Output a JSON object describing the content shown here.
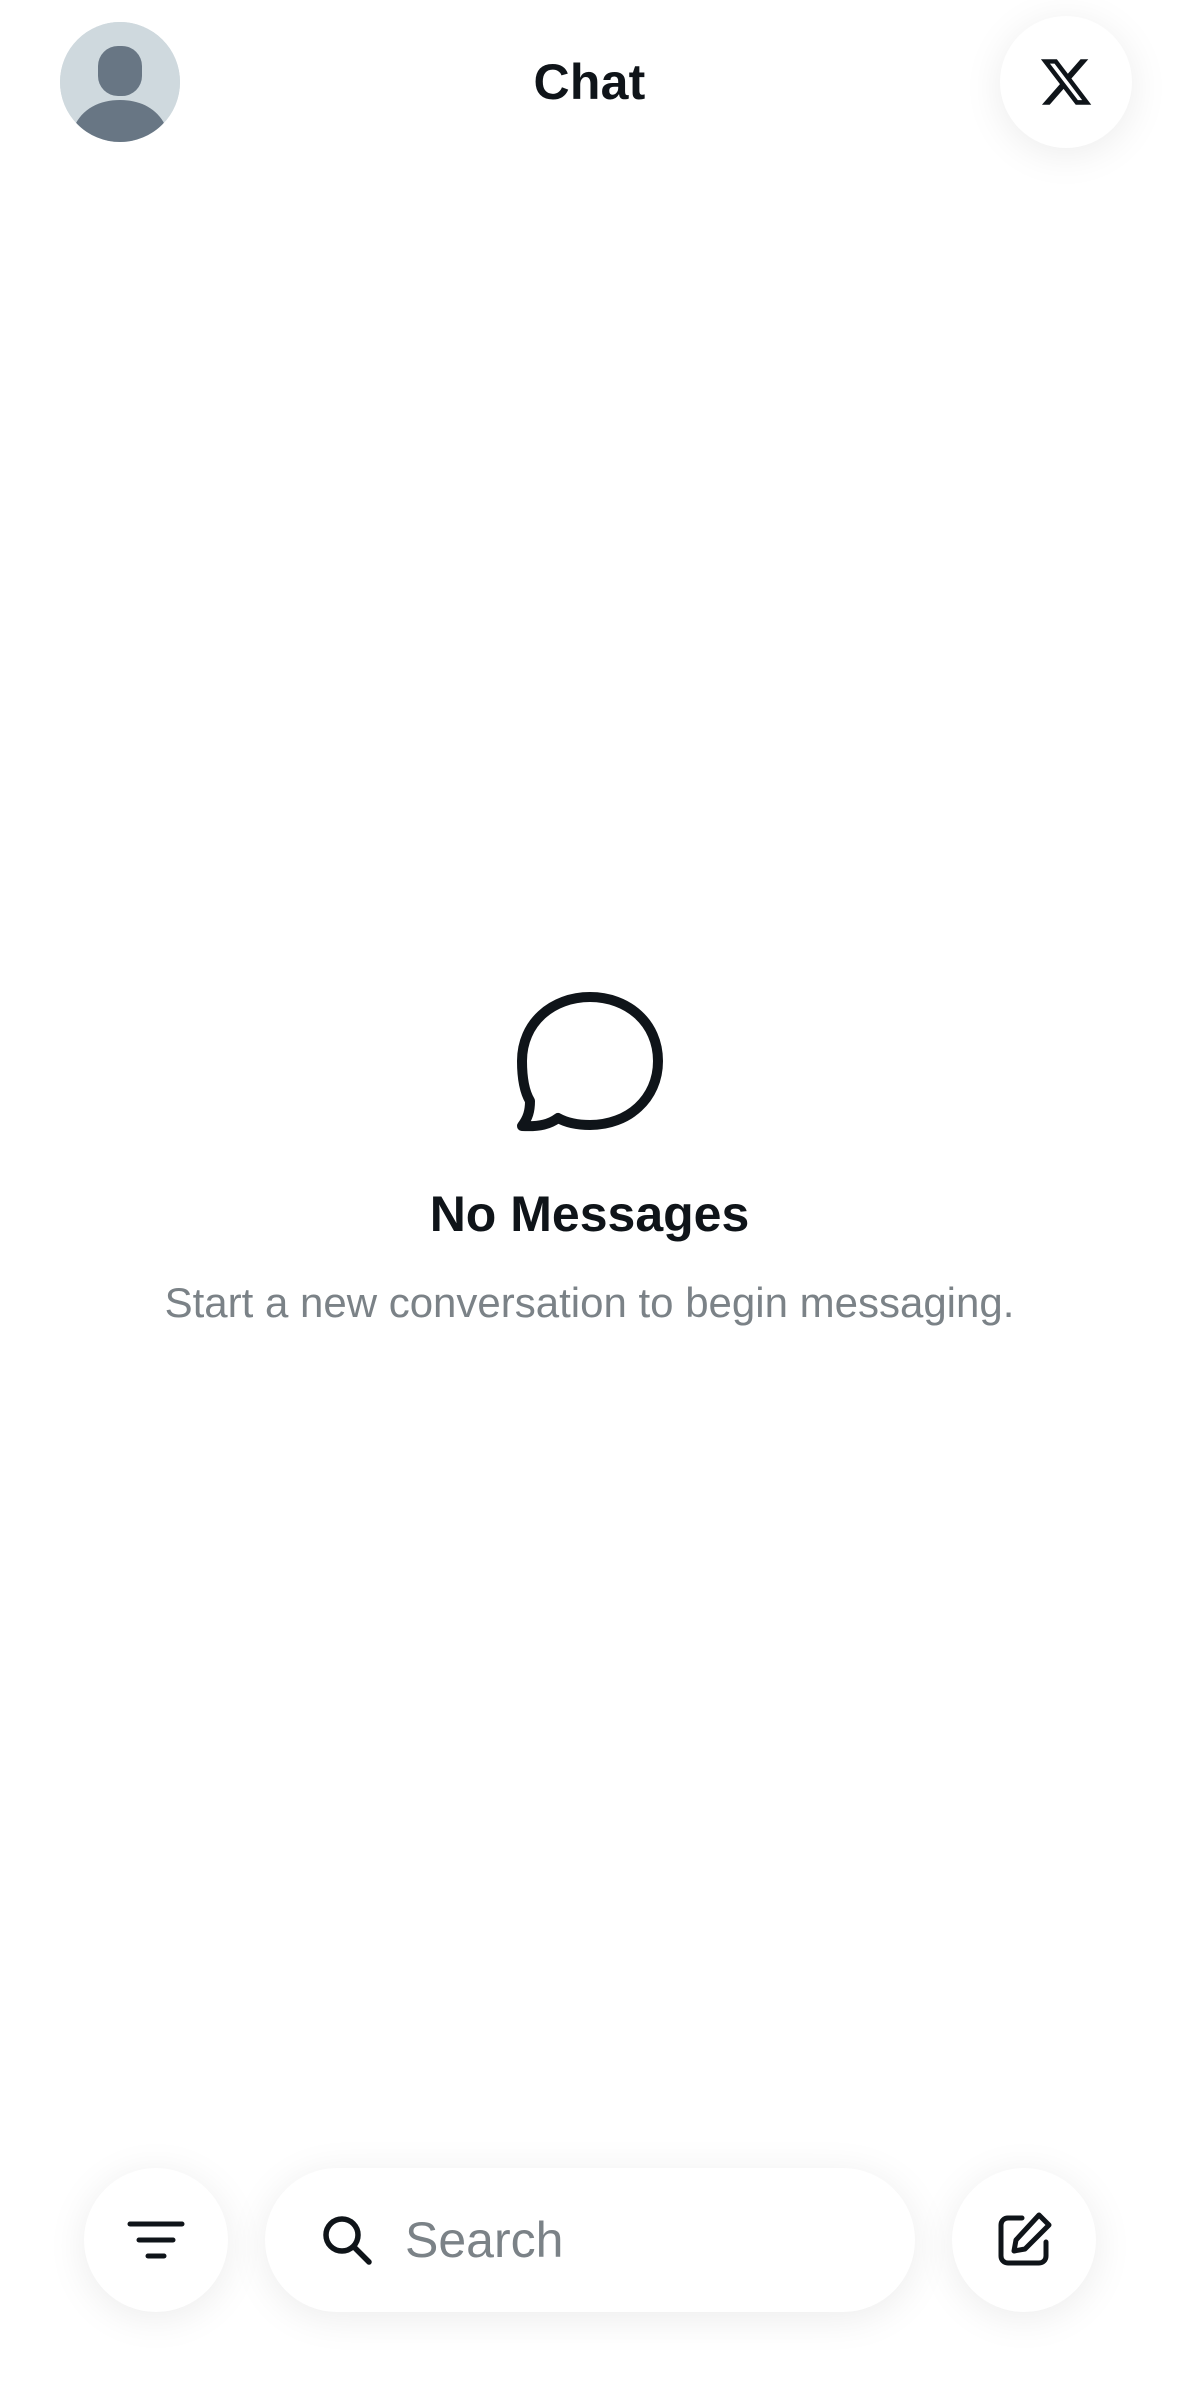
{
  "header": {
    "title": "Chat",
    "avatar_icon": "default-profile-avatar",
    "logo_icon": "x-logo-icon"
  },
  "empty_state": {
    "icon": "chat-bubble-icon",
    "title": "No Messages",
    "subtitle": "Start a new conversation to begin messaging."
  },
  "bottom_bar": {
    "filter_icon": "filter-icon",
    "search": {
      "placeholder": "Search",
      "value": "",
      "icon": "search-icon"
    },
    "compose_icon": "compose-icon"
  },
  "colors": {
    "text_primary": "#0f1419",
    "text_secondary": "#7b8287",
    "avatar_bg": "#cfd9de",
    "avatar_figure": "#687684",
    "background": "#ffffff"
  }
}
